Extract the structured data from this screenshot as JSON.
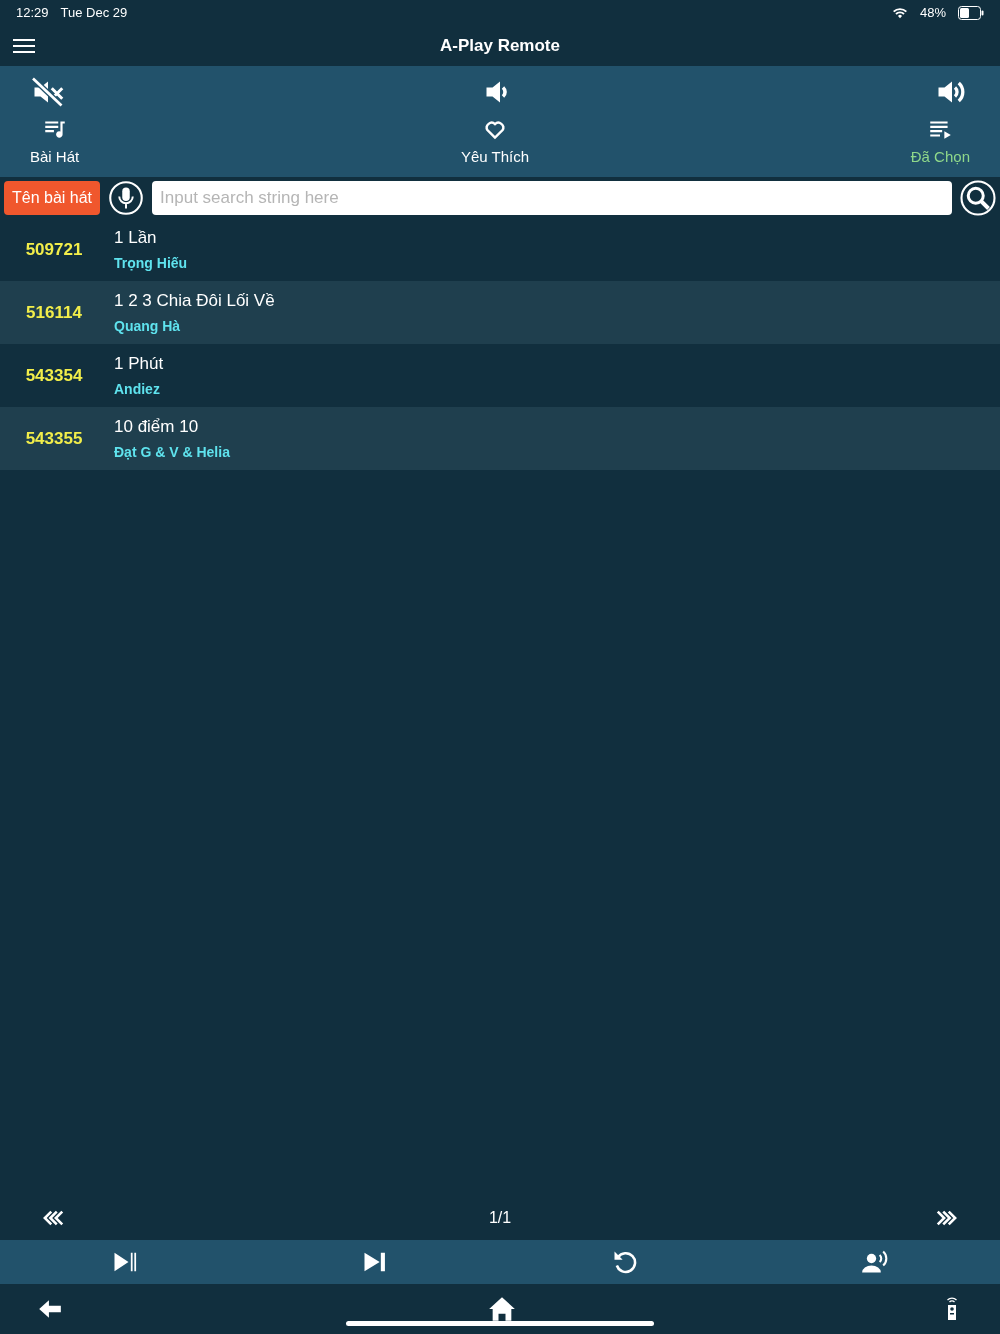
{
  "status_bar": {
    "time": "12:29",
    "date": "Tue Dec 29",
    "battery": "48%"
  },
  "header": {
    "title": "A-Play Remote"
  },
  "tabs": [
    {
      "label": "Bài Hát",
      "kind": "songs",
      "selected": false
    },
    {
      "label": "Yêu Thích",
      "kind": "favorites",
      "selected": false
    },
    {
      "label": "Đã Chọn",
      "kind": "queue",
      "selected": true
    }
  ],
  "search": {
    "mode": "Tên bài hát",
    "placeholder": "Input search string here"
  },
  "songs": [
    {
      "code": "509721",
      "title": "1 Lần",
      "artist": "Trọng Hiếu"
    },
    {
      "code": "516114",
      "title": "1 2 3 Chia Đôi Lối Về",
      "artist": "Quang Hà"
    },
    {
      "code": "543354",
      "title": "1 Phút",
      "artist": "Andiez"
    },
    {
      "code": "543355",
      "title": "10 điểm 10",
      "artist": "Đạt G & V & Helia"
    }
  ],
  "pager": {
    "page": "1/1"
  }
}
